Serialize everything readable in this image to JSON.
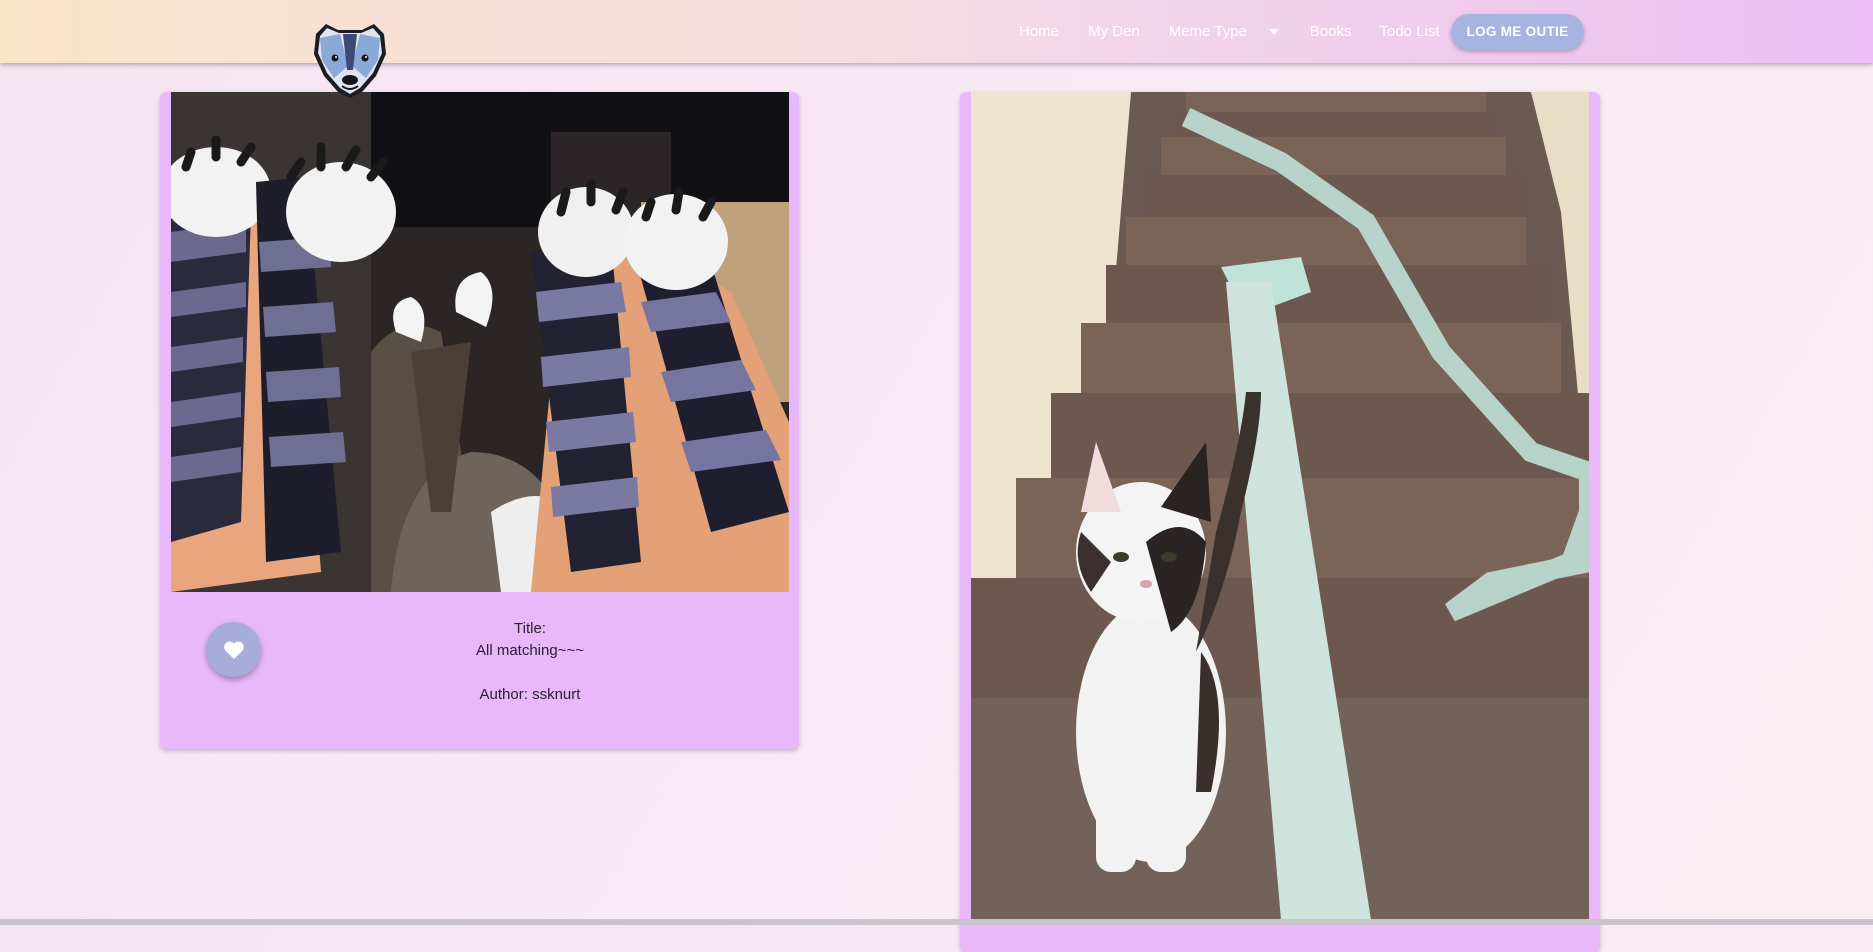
{
  "nav": {
    "items": [
      {
        "label": "Home"
      },
      {
        "label": "My Den"
      },
      {
        "label": "Meme Type"
      },
      {
        "label": "Books"
      },
      {
        "label": "Todo List"
      }
    ],
    "logout_label": "LOG ME OUTIE",
    "logo_icon": "badger-face-icon",
    "dropdown_icon": "caret-down-icon"
  },
  "posts": [
    {
      "title_label": "Title:",
      "title": "All matching~~~",
      "author_text": "Author: ssknurt",
      "like_icon": "heart-icon"
    },
    {}
  ],
  "colors": {
    "card": "#e9b8fa",
    "like_button": "#a7acdb",
    "logout_button": "#a5b4e0"
  }
}
